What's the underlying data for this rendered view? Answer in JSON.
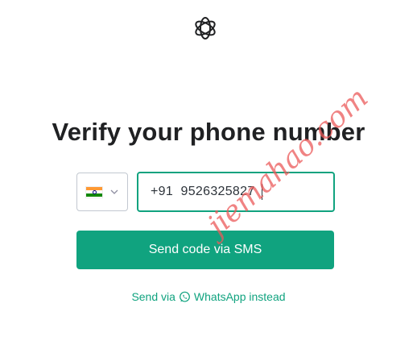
{
  "heading": "Verify your phone number",
  "country": {
    "flag_icon": "india-flag-icon",
    "chevron_icon": "chevron-down-icon"
  },
  "phone": {
    "value": "+91  9526325827"
  },
  "sms_button": {
    "label": "Send code via SMS"
  },
  "whatsapp": {
    "prefix": "Send via",
    "icon": "whatsapp-icon",
    "suffix": "WhatsApp instead"
  },
  "watermark": "jiemahao.com",
  "colors": {
    "accent": "#10a37f",
    "text": "#202123",
    "border": "#c2c8d0",
    "watermark": "#eb5a5a"
  }
}
